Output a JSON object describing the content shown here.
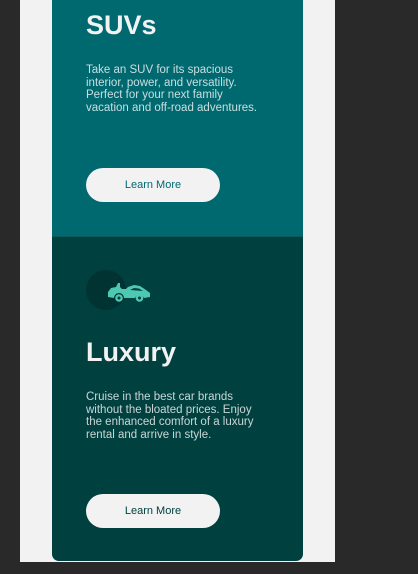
{
  "colors": {
    "page_bg": "#292929",
    "viewport_bg": "#f2f2f2",
    "suvs_card_bg": "#006970",
    "luxury_card_bg": "#00403f",
    "icon_accent": "#4fc8b1",
    "button_bg": "#f2f2f2"
  },
  "cards": {
    "suvs": {
      "title": "SUVs",
      "description": "Take an SUV for its spacious interior, power, and versatility. Perfect for your next family vacation and off-road adventures.",
      "button_label": "Learn More"
    },
    "luxury": {
      "icon": "luxury-car-icon",
      "title": "Luxury",
      "description": "Cruise in the best car brands without the bloated prices. Enjoy the enhanced comfort of a luxury rental and arrive in style.",
      "button_label": "Learn More"
    }
  }
}
